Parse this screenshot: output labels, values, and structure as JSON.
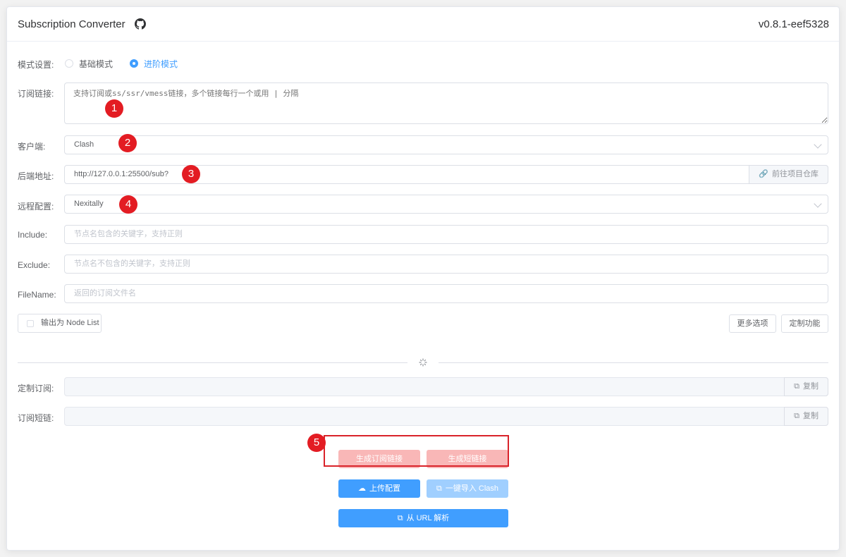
{
  "header": {
    "title": "Subscription Converter",
    "version": "v0.8.1-eef5328"
  },
  "form": {
    "mode": {
      "label": "模式设置:",
      "options": [
        "基础模式",
        "进阶模式"
      ],
      "selected": "进阶模式"
    },
    "subscription": {
      "label": "订阅链接:",
      "placeholder": "支持订阅或ss/ssr/vmess链接，多个链接每行一个或用 | 分隔"
    },
    "client": {
      "label": "客户端:",
      "value": "Clash"
    },
    "backend": {
      "label": "后端地址:",
      "value": "http://127.0.0.1:25500/sub?",
      "append_label": "前往项目仓库"
    },
    "remote": {
      "label": "远程配置:",
      "value": "Nexitally"
    },
    "include": {
      "label": "Include:",
      "placeholder": "节点名包含的关键字，支持正则"
    },
    "exclude": {
      "label": "Exclude:",
      "placeholder": "节点名不包含的关键字，支持正则"
    },
    "filename": {
      "label": "FileName:",
      "placeholder": "返回的订阅文件名"
    },
    "nodelist_label": "输出为 Node List",
    "more_options": "更多选项",
    "custom_features": "定制功能"
  },
  "output": {
    "custom_sub": {
      "label": "定制订阅:",
      "copy": "复制"
    },
    "short_link": {
      "label": "订阅短链:",
      "copy": "复制"
    }
  },
  "actions": {
    "generate_sub": "生成订阅链接",
    "generate_short": "生成短链接",
    "upload_config": "上传配置",
    "import_clash": "一键导入 Clash",
    "parse_url": "从 URL 解析"
  },
  "annotations": [
    "1",
    "2",
    "3",
    "4",
    "5"
  ],
  "colors": {
    "primary": "#409eff",
    "danger_light": "#f9b7b7",
    "annotation_red": "#e31c23"
  }
}
